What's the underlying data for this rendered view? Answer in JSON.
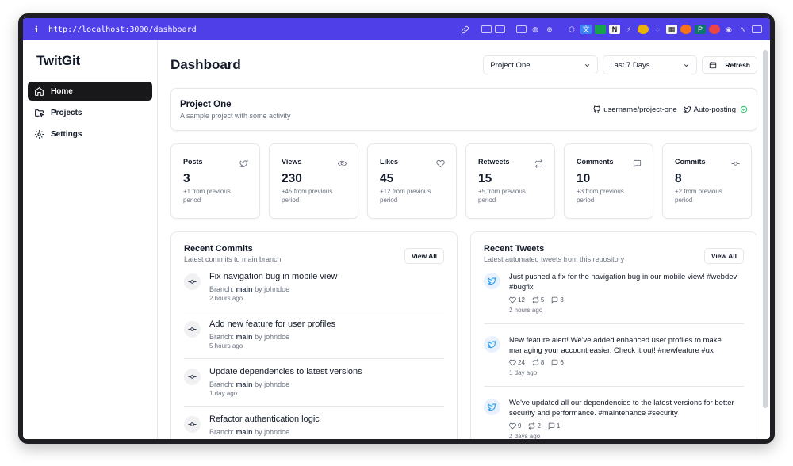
{
  "browser": {
    "url": "http://localhost:3000/dashboard",
    "extension_icons": [
      "link-icon",
      "screenshot-icon",
      "camera-icon",
      "window-icon",
      "globe-icon",
      "crosshair-icon",
      "gamepad-icon",
      "translate-icon",
      "green-square-icon",
      "notion-icon",
      "bolt-icon",
      "shield-icon",
      "swirl-icon",
      "calendar-icon",
      "metamask-icon",
      "ext-p-icon",
      "face-icon",
      "chrome-icon",
      "wave-icon",
      "sidebar-icon"
    ]
  },
  "sidebar": {
    "brand": "TwitGit",
    "items": [
      {
        "label": "Home",
        "icon": "home-icon",
        "active": true
      },
      {
        "label": "Projects",
        "icon": "folder-icon",
        "active": false
      },
      {
        "label": "Settings",
        "icon": "gear-icon",
        "active": false
      }
    ]
  },
  "header": {
    "title": "Dashboard",
    "project_select": "Project One",
    "range_select": "Last 7 Days",
    "refresh_label": "Refresh"
  },
  "project": {
    "name": "Project One",
    "description": "A sample project with some activity",
    "repo": "username/project-one",
    "autopost": "Auto-posting"
  },
  "stats": [
    {
      "label": "Posts",
      "value": "3",
      "change": "+1 from previous period",
      "icon": "twitter-icon"
    },
    {
      "label": "Views",
      "value": "230",
      "change": "+45 from previous period",
      "icon": "eye-icon"
    },
    {
      "label": "Likes",
      "value": "45",
      "change": "+12 from previous period",
      "icon": "heart-icon"
    },
    {
      "label": "Retweets",
      "value": "15",
      "change": "+5 from previous period",
      "icon": "repeat-icon"
    },
    {
      "label": "Comments",
      "value": "10",
      "change": "+3 from previous period",
      "icon": "comment-icon"
    },
    {
      "label": "Commits",
      "value": "8",
      "change": "+2 from previous period",
      "icon": "commit-icon"
    }
  ],
  "commits_panel": {
    "title": "Recent Commits",
    "subtitle": "Latest commits to main branch",
    "view_all": "View All",
    "branch_prefix": "Branch:",
    "by_word": "by",
    "items": [
      {
        "message": "Fix navigation bug in mobile view",
        "branch": "main",
        "author": "johndoe",
        "time": "2 hours ago"
      },
      {
        "message": "Add new feature for user profiles",
        "branch": "main",
        "author": "johndoe",
        "time": "5 hours ago"
      },
      {
        "message": "Update dependencies to latest versions",
        "branch": "main",
        "author": "johndoe",
        "time": "1 day ago"
      },
      {
        "message": "Refactor authentication logic",
        "branch": "main",
        "author": "johndoe",
        "time": ""
      }
    ]
  },
  "tweets_panel": {
    "title": "Recent Tweets",
    "subtitle": "Latest automated tweets from this repository",
    "view_all": "View All",
    "items": [
      {
        "text": "Just pushed a fix for the navigation bug in our mobile view! #webdev #bugfix",
        "likes": "12",
        "retweets": "5",
        "comments": "3",
        "time": "2 hours ago"
      },
      {
        "text": "New feature alert! We've added enhanced user profiles to make managing your account easier. Check it out! #newfeature #ux",
        "likes": "24",
        "retweets": "8",
        "comments": "6",
        "time": "1 day ago"
      },
      {
        "text": "We've updated all our dependencies to the latest versions for better security and performance. #maintenance #security",
        "likes": "9",
        "retweets": "2",
        "comments": "1",
        "time": "2 days ago"
      }
    ]
  },
  "colors": {
    "browser_bar": "#4f3fe8",
    "active_nav": "#18181b",
    "border": "#e5e7eb",
    "muted_text": "#6b7280",
    "twitter_blue": "#1d9bf0",
    "success_green": "#22c55e"
  }
}
